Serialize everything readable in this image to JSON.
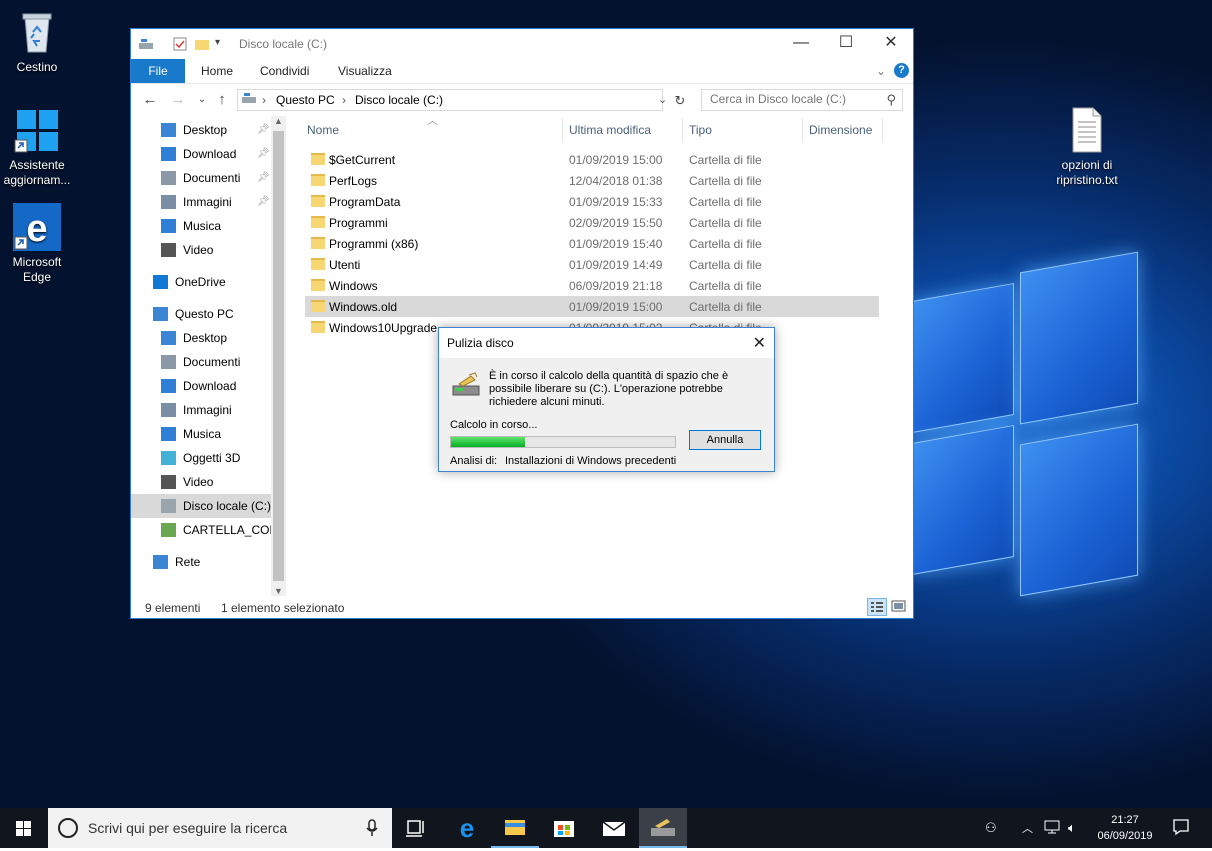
{
  "desktop": {
    "icons": [
      {
        "name": "recycle-bin",
        "label": "Cestino"
      },
      {
        "name": "update-assistant",
        "label": "Assistente aggiornam..."
      },
      {
        "name": "microsoft-edge",
        "label": "Microsoft Edge"
      },
      {
        "name": "restore-options-file",
        "label": "opzioni di ripristino.txt"
      }
    ]
  },
  "explorer": {
    "title": "Disco locale (C:)",
    "ribbon_tabs": [
      "File",
      "Home",
      "Condividi",
      "Visualizza"
    ],
    "breadcrumb": [
      "Questo PC",
      "Disco locale (C:)"
    ],
    "search_placeholder": "Cerca in Disco locale (C:)",
    "nav_items": [
      {
        "label": "Desktop",
        "icon": "desktop-icon",
        "pinned": true
      },
      {
        "label": "Download",
        "icon": "download-icon",
        "pinned": true
      },
      {
        "label": "Documenti",
        "icon": "documents-icon",
        "pinned": true
      },
      {
        "label": "Immagini",
        "icon": "pictures-icon",
        "pinned": true
      },
      {
        "label": "Musica",
        "icon": "music-icon",
        "pinned": false
      },
      {
        "label": "Video",
        "icon": "video-icon",
        "pinned": false
      },
      {
        "label": "OneDrive",
        "icon": "onedrive-icon",
        "pinned": false
      },
      {
        "label": "Questo PC",
        "icon": "this-pc-icon",
        "pinned": false
      },
      {
        "label": "Desktop",
        "icon": "desktop-icon",
        "pinned": false
      },
      {
        "label": "Documenti",
        "icon": "documents-icon",
        "pinned": false
      },
      {
        "label": "Download",
        "icon": "download-icon",
        "pinned": false
      },
      {
        "label": "Immagini",
        "icon": "pictures-icon",
        "pinned": false
      },
      {
        "label": "Musica",
        "icon": "music-icon",
        "pinned": false
      },
      {
        "label": "Oggetti 3D",
        "icon": "3d-objects-icon",
        "pinned": false
      },
      {
        "label": "Video",
        "icon": "video-icon",
        "pinned": false
      },
      {
        "label": "Disco locale (C:)",
        "icon": "local-disk-icon",
        "pinned": false,
        "selected": true
      },
      {
        "label": "CARTELLA_CON",
        "icon": "network-drive-icon",
        "pinned": false
      },
      {
        "label": "Rete",
        "icon": "network-icon",
        "pinned": false
      }
    ],
    "columns": [
      "Nome",
      "Ultima modifica",
      "Tipo",
      "Dimensione"
    ],
    "rows": [
      {
        "name": "$GetCurrent",
        "date": "01/09/2019 15:00",
        "type": "Cartella di file"
      },
      {
        "name": "PerfLogs",
        "date": "12/04/2018 01:38",
        "type": "Cartella di file"
      },
      {
        "name": "ProgramData",
        "date": "01/09/2019 15:33",
        "type": "Cartella di file"
      },
      {
        "name": "Programmi",
        "date": "02/09/2019 15:50",
        "type": "Cartella di file"
      },
      {
        "name": "Programmi (x86)",
        "date": "01/09/2019 15:40",
        "type": "Cartella di file"
      },
      {
        "name": "Utenti",
        "date": "01/09/2019 14:49",
        "type": "Cartella di file"
      },
      {
        "name": "Windows",
        "date": "06/09/2019 21:18",
        "type": "Cartella di file"
      },
      {
        "name": "Windows.old",
        "date": "01/09/2019 15:00",
        "type": "Cartella di file",
        "selected": true
      },
      {
        "name": "Windows10Upgrade",
        "date": "01/09/2019 15:02",
        "type": "Cartella di file"
      }
    ],
    "status": {
      "count": "9 elementi",
      "selection": "1 elemento selezionato"
    }
  },
  "dialog": {
    "title": "Pulizia disco",
    "message": "È in corso il calcolo della quantità di spazio che è possibile liberare su  (C:). L'operazione potrebbe richiedere alcuni minuti.",
    "progress_label": "Calcolo in corso...",
    "progress_percent": 33,
    "cancel_label": "Annulla",
    "analysis_label": "Analisi di:",
    "analysis_value": "Installazioni di Windows precedenti"
  },
  "taskbar": {
    "search_placeholder": "Scrivi qui per eseguire la ricerca",
    "time": "21:27",
    "date": "06/09/2019"
  }
}
